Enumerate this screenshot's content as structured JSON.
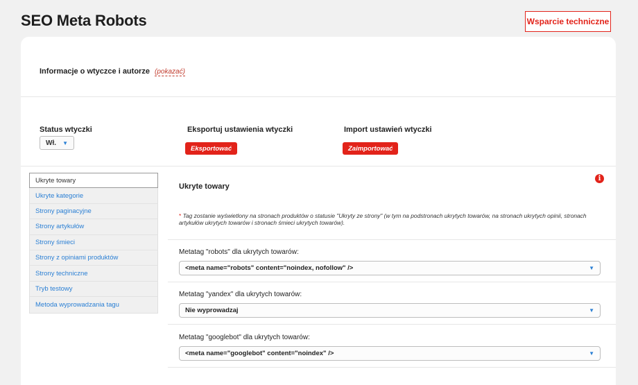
{
  "header": {
    "title": "SEO Meta Robots",
    "support_label": "Wsparcie techniczne"
  },
  "info": {
    "label": "Informacje o wtyczce i autorze",
    "show_link": "(pokazać)"
  },
  "status": {
    "label": "Status wtyczki",
    "value": "Wł."
  },
  "export": {
    "label": "Eksportuj ustawienia wtyczki",
    "button": "Eksportować"
  },
  "import": {
    "label": "Import ustawień wtyczki",
    "button": "Zaimportować"
  },
  "sidebar": {
    "items": [
      {
        "label": "Ukryte towary"
      },
      {
        "label": "Ukryte kategorie"
      },
      {
        "label": "Strony paginacyjne"
      },
      {
        "label": "Strony artykułów"
      },
      {
        "label": "Strony śmieci"
      },
      {
        "label": "Strony z opiniami produktów"
      },
      {
        "label": "Strony techniczne"
      },
      {
        "label": "Tryb testowy"
      },
      {
        "label": "Metoda wyprowadzania tagu"
      }
    ]
  },
  "section": {
    "title": "Ukryte towary",
    "note_star": "*",
    "note": "Tag zostanie wyświetlony na stronach produktów o statusie \"Ukryty ze strony\" (w tym na podstronach ukrytych towarów, na stronach ukrytych opinii, stronach artykułów ukrytych towarów i stronach śmieci ukrytych towarów).",
    "fields": [
      {
        "label": "Metatag \"robots\" dla ukrytych towarów:",
        "value": "<meta name=\"robots\" content=\"noindex, nofollow\" />"
      },
      {
        "label": "Metatag \"yandex\" dla ukrytych towarów:",
        "value": "Nie wyprowadzaj"
      },
      {
        "label": "Metatag \"googlebot\" dla ukrytych towarów:",
        "value": "<meta name=\"googlebot\" content=\"noindex\" />"
      }
    ]
  },
  "icons": {
    "info": "info-icon",
    "caret": "chevron-down-icon"
  },
  "colors": {
    "accent_red": "#e2231a",
    "link_blue": "#2a7fd4"
  }
}
